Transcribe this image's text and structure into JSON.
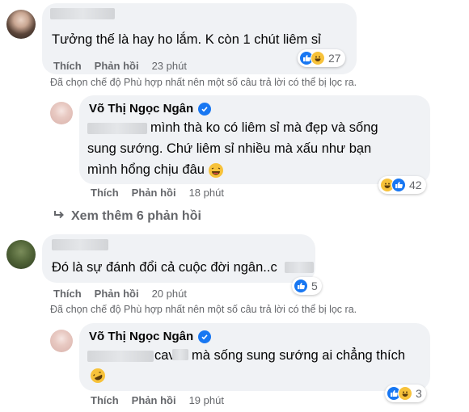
{
  "comments": [
    {
      "text": "Tưởng thế là hay ho lắm. K còn 1 chút liêm sỉ",
      "actions": {
        "like": "Thích",
        "reply": "Phản hồi",
        "time": "23 phút"
      },
      "reaction_count": "27"
    },
    {
      "text": "Đó là sự đánh đổi cả cuộc đời ngân..c",
      "actions": {
        "like": "Thích",
        "reply": "Phản hồi",
        "time": "20 phút"
      },
      "reaction_count": "5"
    }
  ],
  "filter_note": "Đã chọn chế độ Phù hợp nhất nên một số câu trả lời có thể bị lọc ra.",
  "replies": [
    {
      "name": "Võ Thị Ngọc Ngân",
      "line1": "mình thà ko có liêm sỉ mà đẹp và sống",
      "line2": "sung sướng. Chứ liêm sỉ nhiều mà xấu như bạn",
      "line3": "mình hổng chịu đâu",
      "actions": {
        "like": "Thích",
        "reply": "Phản hồi",
        "time": "18 phút"
      },
      "reaction_count": "42"
    },
    {
      "name": "Võ Thị Ngọc Ngân",
      "line1a": "cav",
      "line1b": "mà sống sung sướng ai chẳng thích",
      "actions": {
        "like": "Thích",
        "reply": "Phản hồi",
        "time": "19 phút"
      },
      "reaction_count": "3"
    }
  ],
  "view_more": "Xem thêm 6 phản hồi",
  "icons": {
    "like": "like-icon",
    "haha": "haha-icon",
    "verified": "verified-badge-icon",
    "reply_arrow": "reply-arrow-icon"
  },
  "colors": {
    "accent": "#1877f2",
    "bubble": "#f0f2f5",
    "muted": "#65676b"
  }
}
